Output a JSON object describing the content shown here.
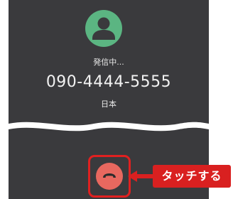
{
  "call": {
    "status": "発信中...",
    "number": "090-4444-5555",
    "country": "日本"
  },
  "icons": {
    "avatar": "person-icon",
    "hangup": "phone-hangup-icon"
  },
  "annotation": {
    "label": "タッチする"
  },
  "colors": {
    "background": "#3a3a3d",
    "avatar": "#5bb582",
    "hangup": "#e8685f",
    "annotation": "#d92020"
  }
}
